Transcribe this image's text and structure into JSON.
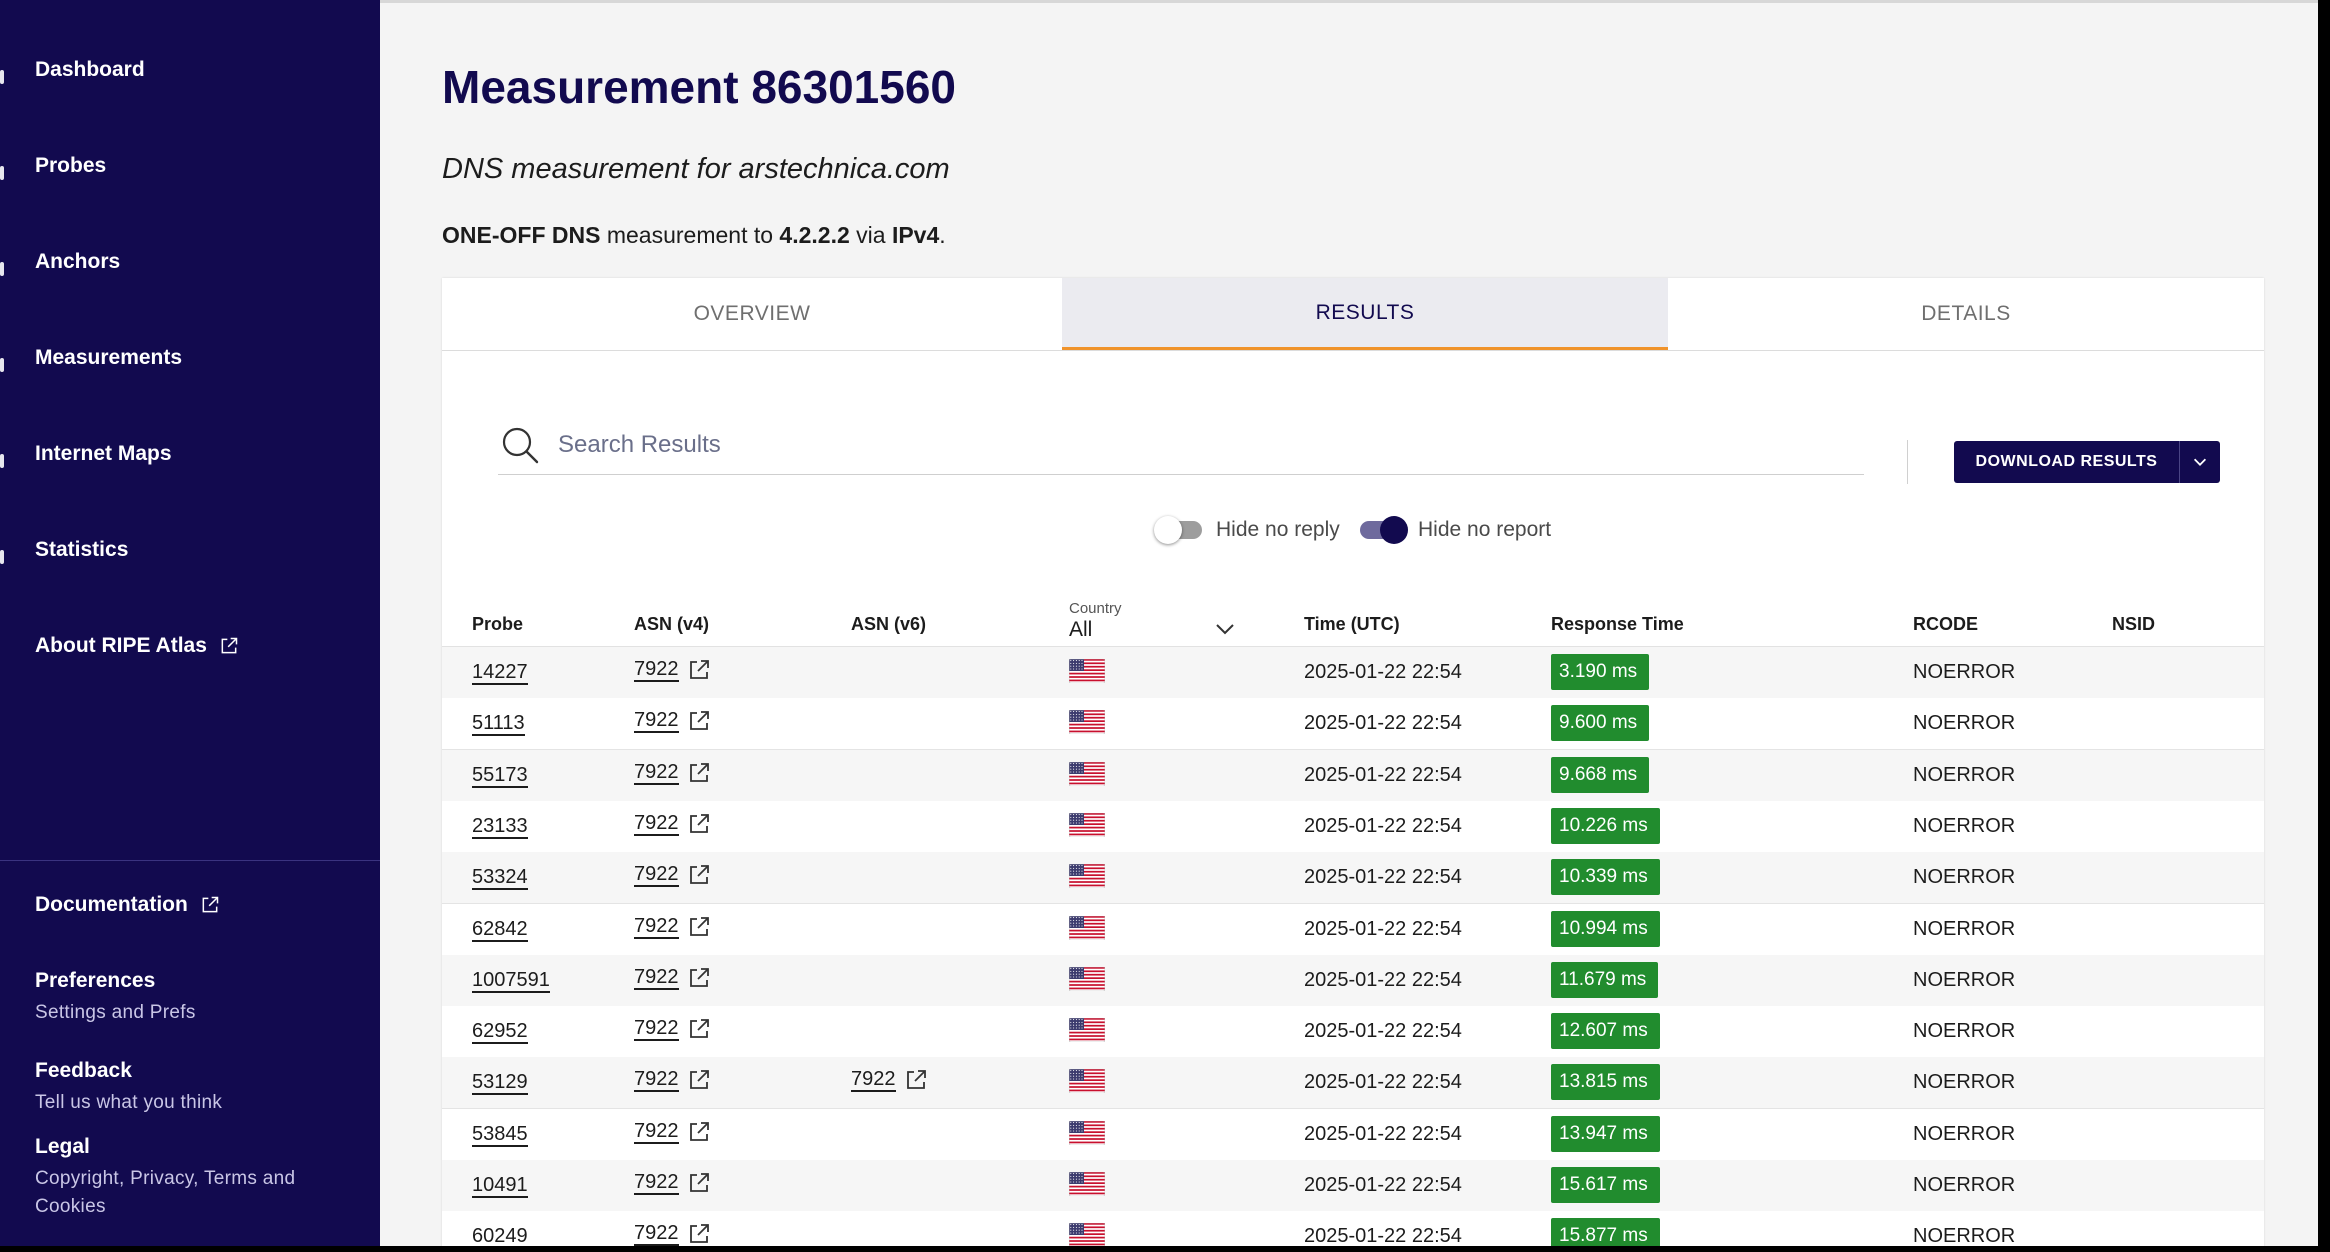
{
  "sidebar": {
    "nav": [
      {
        "label": "Dashboard",
        "external": false
      },
      {
        "label": "Probes",
        "external": false
      },
      {
        "label": "Anchors",
        "external": false
      },
      {
        "label": "Measurements",
        "external": false
      },
      {
        "label": "Internet Maps",
        "external": false
      },
      {
        "label": "Statistics",
        "external": false
      },
      {
        "label": "About RIPE Atlas",
        "external": true
      }
    ],
    "bottom": [
      {
        "label": "Documentation",
        "desc": "",
        "external": true
      },
      {
        "label": "Preferences",
        "desc": "Settings and Prefs",
        "external": false
      },
      {
        "label": "Feedback",
        "desc": "Tell us what you think",
        "external": false
      },
      {
        "label": "Legal",
        "desc": "Copyright, Privacy, Terms and Cookies",
        "external": false
      }
    ]
  },
  "header": {
    "title": "Measurement 86301560",
    "subtitle": "DNS measurement for arstechnica.com",
    "summary": {
      "type": "ONE-OFF DNS",
      "text1": " measurement to ",
      "target": "4.2.2.2",
      "text2": " via ",
      "af": "IPv4",
      "end": "."
    }
  },
  "tabs": [
    {
      "label": "OVERVIEW",
      "active": false
    },
    {
      "label": "RESULTS",
      "active": true
    },
    {
      "label": "DETAILS",
      "active": false
    }
  ],
  "search": {
    "placeholder": "Search Results",
    "value": ""
  },
  "download": {
    "label": "DOWNLOAD RESULTS"
  },
  "toggles": [
    {
      "label": "Hide no reply",
      "on": false
    },
    {
      "label": "Hide no report",
      "on": true
    }
  ],
  "table": {
    "columns": {
      "probe": "Probe",
      "asn_v4": "ASN (v4)",
      "asn_v6": "ASN (v6)",
      "country_label": "Country",
      "country_value": "All",
      "time": "Time (UTC)",
      "response": "Response Time",
      "rcode": "RCODE",
      "nsid": "NSID"
    },
    "rows": [
      {
        "probe": "14227",
        "asn_v4": "7922",
        "asn_v6": "",
        "time": "2025-01-22 22:54",
        "response": "3.190 ms",
        "rcode": "NOERROR",
        "nsid": ""
      },
      {
        "probe": "51113",
        "asn_v4": "7922",
        "asn_v6": "",
        "time": "2025-01-22 22:54",
        "response": "9.600 ms",
        "rcode": "NOERROR",
        "nsid": ""
      },
      {
        "probe": "55173",
        "asn_v4": "7922",
        "asn_v6": "",
        "time": "2025-01-22 22:54",
        "response": "9.668 ms",
        "rcode": "NOERROR",
        "nsid": ""
      },
      {
        "probe": "23133",
        "asn_v4": "7922",
        "asn_v6": "",
        "time": "2025-01-22 22:54",
        "response": "10.226 ms",
        "rcode": "NOERROR",
        "nsid": ""
      },
      {
        "probe": "53324",
        "asn_v4": "7922",
        "asn_v6": "",
        "time": "2025-01-22 22:54",
        "response": "10.339 ms",
        "rcode": "NOERROR",
        "nsid": ""
      },
      {
        "probe": "62842",
        "asn_v4": "7922",
        "asn_v6": "",
        "time": "2025-01-22 22:54",
        "response": "10.994 ms",
        "rcode": "NOERROR",
        "nsid": ""
      },
      {
        "probe": "1007591",
        "asn_v4": "7922",
        "asn_v6": "",
        "time": "2025-01-22 22:54",
        "response": "11.679 ms",
        "rcode": "NOERROR",
        "nsid": ""
      },
      {
        "probe": "62952",
        "asn_v4": "7922",
        "asn_v6": "",
        "time": "2025-01-22 22:54",
        "response": "12.607 ms",
        "rcode": "NOERROR",
        "nsid": ""
      },
      {
        "probe": "53129",
        "asn_v4": "7922",
        "asn_v6": "7922",
        "time": "2025-01-22 22:54",
        "response": "13.815 ms",
        "rcode": "NOERROR",
        "nsid": ""
      },
      {
        "probe": "53845",
        "asn_v4": "7922",
        "asn_v6": "",
        "time": "2025-01-22 22:54",
        "response": "13.947 ms",
        "rcode": "NOERROR",
        "nsid": ""
      },
      {
        "probe": "10491",
        "asn_v4": "7922",
        "asn_v6": "",
        "time": "2025-01-22 22:54",
        "response": "15.617 ms",
        "rcode": "NOERROR",
        "nsid": ""
      },
      {
        "probe": "60249",
        "asn_v4": "7922",
        "asn_v6": "",
        "time": "2025-01-22 22:54",
        "response": "15.877 ms",
        "rcode": "NOERROR",
        "nsid": ""
      }
    ]
  },
  "colors": {
    "sidebar_bg": "#120a4f",
    "accent": "#f0932b",
    "badge_green": "#218c2e"
  },
  "icons": {
    "external": "external-link-icon",
    "search": "search-icon",
    "flag": "us-flag-icon",
    "chevron": "chevron-down-icon"
  }
}
